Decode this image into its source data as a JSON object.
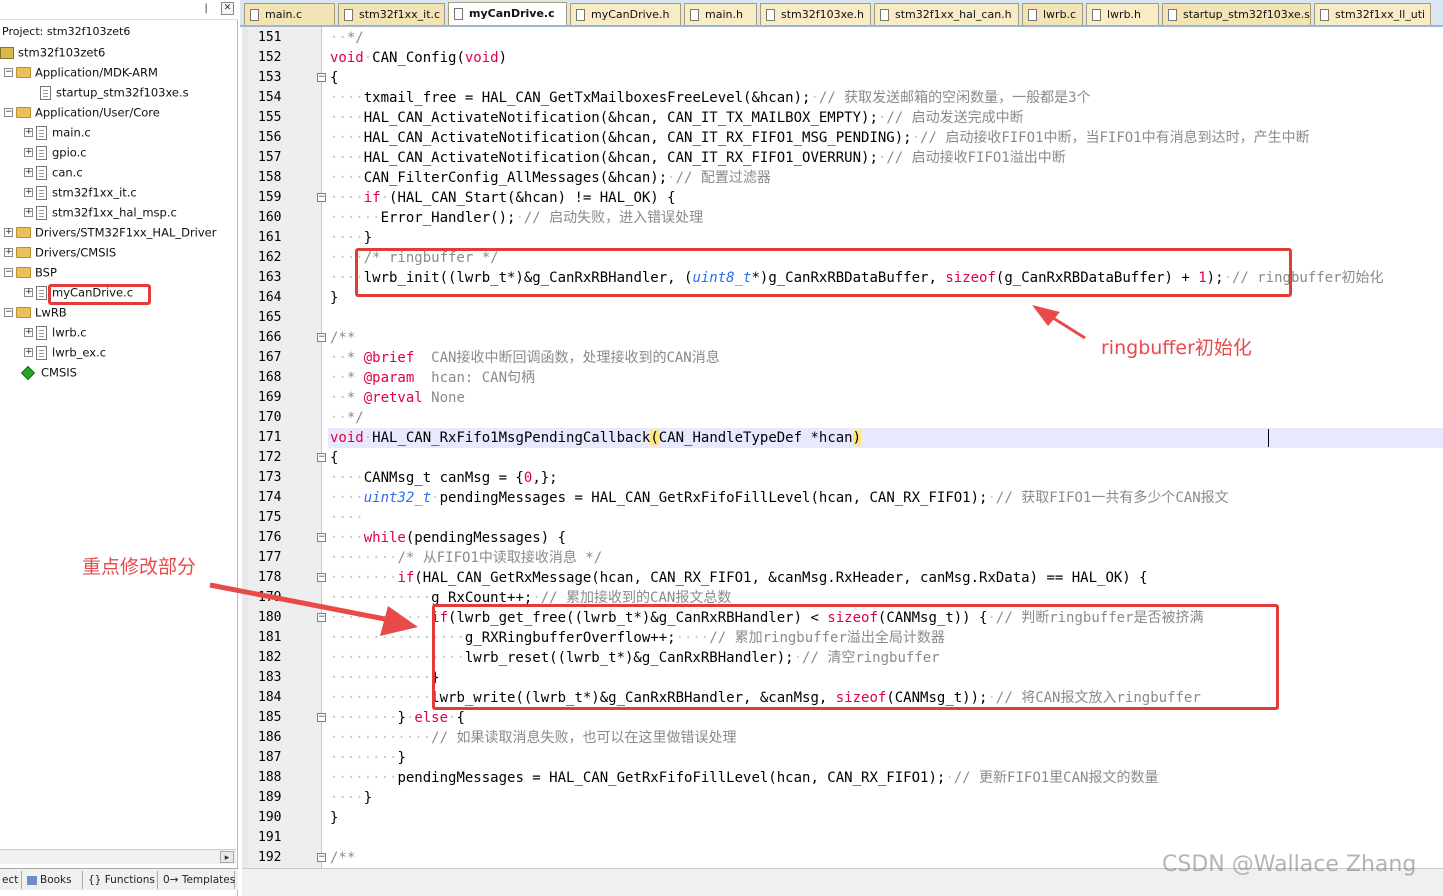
{
  "project": {
    "title": "Project: stm32f103zet6",
    "tree": [
      {
        "label": "stm32f103zet6",
        "kind": "project",
        "indent": 0
      },
      {
        "label": "Application/MDK-ARM",
        "kind": "folder",
        "indent": 1,
        "expander": "-"
      },
      {
        "label": "startup_stm32f103xe.s",
        "kind": "file",
        "indent": 3
      },
      {
        "label": "Application/User/Core",
        "kind": "folder",
        "indent": 1,
        "expander": "-"
      },
      {
        "label": "main.c",
        "kind": "file",
        "indent": 2,
        "expander": "+"
      },
      {
        "label": "gpio.c",
        "kind": "file",
        "indent": 2,
        "expander": "+"
      },
      {
        "label": "can.c",
        "kind": "file",
        "indent": 2,
        "expander": "+"
      },
      {
        "label": "stm32f1xx_it.c",
        "kind": "file",
        "indent": 2,
        "expander": "+"
      },
      {
        "label": "stm32f1xx_hal_msp.c",
        "kind": "file",
        "indent": 2,
        "expander": "+"
      },
      {
        "label": "Drivers/STM32F1xx_HAL_Driver",
        "kind": "folder",
        "indent": 1,
        "expander": "+"
      },
      {
        "label": "Drivers/CMSIS",
        "kind": "folder",
        "indent": 1,
        "expander": "+"
      },
      {
        "label": "BSP",
        "kind": "folder",
        "indent": 1,
        "expander": "-"
      },
      {
        "label": "myCanDrive.c",
        "kind": "file",
        "indent": 2,
        "expander": "+"
      },
      {
        "label": "LwRB",
        "kind": "folder",
        "indent": 1,
        "expander": "-"
      },
      {
        "label": "lwrb.c",
        "kind": "file",
        "indent": 2,
        "expander": "+"
      },
      {
        "label": "lwrb_ex.c",
        "kind": "file",
        "indent": 2,
        "expander": "+"
      },
      {
        "label": "CMSIS",
        "kind": "gem",
        "indent": 1
      }
    ],
    "bottom_tabs": [
      "ect",
      "Books",
      "{} Functions",
      "0→ Templates"
    ]
  },
  "tabs": [
    {
      "label": "main.c",
      "type": "c",
      "active": false
    },
    {
      "label": "stm32f1xx_it.c",
      "type": "c",
      "active": false
    },
    {
      "label": "myCanDrive.c",
      "type": "c",
      "active": true
    },
    {
      "label": "myCanDrive.h",
      "type": "h",
      "active": false
    },
    {
      "label": "main.h",
      "type": "h",
      "active": false
    },
    {
      "label": "stm32f103xe.h",
      "type": "h",
      "active": false
    },
    {
      "label": "stm32f1xx_hal_can.h",
      "type": "h",
      "active": false
    },
    {
      "label": "lwrb.c",
      "type": "c",
      "active": false
    },
    {
      "label": "lwrb.h",
      "type": "h",
      "active": false
    },
    {
      "label": "startup_stm32f103xe.s",
      "type": "s",
      "active": false
    },
    {
      "label": "stm32f1xx_ll_uti",
      "type": "h",
      "active": false
    }
  ],
  "colors": {
    "keyword": "#e00040",
    "type": "#2a6ef3",
    "comment": "#8a8a8a",
    "annotation": "#e33a3a"
  },
  "code": [
    {
      "n": 151,
      "fold": "",
      "segs": [
        [
          "ws",
          "··"
        ],
        [
          "cm",
          "*/"
        ]
      ]
    },
    {
      "n": 152,
      "fold": "",
      "segs": [
        [
          "kw",
          "void"
        ],
        [
          "ws",
          "·"
        ],
        [
          "",
          "CAN_Config("
        ],
        [
          "kw",
          "void"
        ],
        [
          "",
          ")"
        ]
      ]
    },
    {
      "n": 153,
      "fold": "-",
      "segs": [
        [
          "",
          "{"
        ]
      ]
    },
    {
      "n": 154,
      "fold": "",
      "segs": [
        [
          "ws",
          "····"
        ],
        [
          "",
          "txmail_free = HAL_CAN_GetTxMailboxesFreeLevel(&hcan);"
        ],
        [
          "ws",
          "·"
        ],
        [
          "cm",
          "// 获取发送邮箱的空闲数量，一般都是3个"
        ]
      ]
    },
    {
      "n": 155,
      "fold": "",
      "segs": [
        [
          "ws",
          "····"
        ],
        [
          "",
          "HAL_CAN_ActivateNotification(&hcan, CAN_IT_TX_MAILBOX_EMPTY);"
        ],
        [
          "ws",
          "·"
        ],
        [
          "cm",
          "// 启动发送完成中断"
        ]
      ]
    },
    {
      "n": 156,
      "fold": "",
      "segs": [
        [
          "ws",
          "····"
        ],
        [
          "",
          "HAL_CAN_ActivateNotification(&hcan, CAN_IT_RX_FIFO1_MSG_PENDING);"
        ],
        [
          "ws",
          "·"
        ],
        [
          "cm",
          "// 启动接收FIFO1中断，当FIFO1中有消息到达时，产生中断"
        ]
      ]
    },
    {
      "n": 157,
      "fold": "",
      "segs": [
        [
          "ws",
          "····"
        ],
        [
          "",
          "HAL_CAN_ActivateNotification(&hcan, CAN_IT_RX_FIFO1_OVERRUN);"
        ],
        [
          "ws",
          "·"
        ],
        [
          "cm",
          "// 启动接收FIFO1溢出中断"
        ]
      ]
    },
    {
      "n": 158,
      "fold": "",
      "segs": [
        [
          "ws",
          "····"
        ],
        [
          "",
          "CAN_FilterConfig_AllMessages(&hcan);"
        ],
        [
          "ws",
          "·"
        ],
        [
          "cm",
          "// 配置过滤器"
        ]
      ]
    },
    {
      "n": 159,
      "fold": "-",
      "segs": [
        [
          "ws",
          "····"
        ],
        [
          "kw",
          "if"
        ],
        [
          "",
          ""
        ],
        [
          "ws",
          "·"
        ],
        [
          "",
          "(HAL_CAN_Start(&hcan) != HAL_OK) {"
        ]
      ]
    },
    {
      "n": 160,
      "fold": "",
      "segs": [
        [
          "ws",
          "······"
        ],
        [
          "",
          "Error_Handler();"
        ],
        [
          "ws",
          "·"
        ],
        [
          "cm",
          "// 启动失败，进入错误处理"
        ]
      ]
    },
    {
      "n": 161,
      "fold": "",
      "segs": [
        [
          "ws",
          "····"
        ],
        [
          "",
          "}"
        ]
      ]
    },
    {
      "n": 162,
      "fold": "",
      "segs": [
        [
          "ws",
          "····"
        ],
        [
          "cm",
          "/* ringbuffer */"
        ]
      ]
    },
    {
      "n": 163,
      "fold": "",
      "segs": [
        [
          "ws",
          "····"
        ],
        [
          "",
          "lwrb_init((lwrb_t*)&g_CanRxRBHandler, ("
        ],
        [
          "ty",
          "uint8_t"
        ],
        [
          "",
          "*)g_CanRxRBDataBuffer, "
        ],
        [
          "kw",
          "sizeof"
        ],
        [
          "",
          "(g_CanRxRBDataBuffer) + "
        ],
        [
          "num",
          "1"
        ],
        [
          "",
          ");"
        ],
        [
          "ws",
          "·"
        ],
        [
          "cm",
          "// ringbuffer初始化"
        ]
      ]
    },
    {
      "n": 164,
      "fold": "",
      "segs": [
        [
          "",
          "}"
        ]
      ]
    },
    {
      "n": 165,
      "fold": "",
      "segs": []
    },
    {
      "n": 166,
      "fold": "-",
      "segs": [
        [
          "cm",
          "/**"
        ]
      ]
    },
    {
      "n": 167,
      "fold": "",
      "segs": [
        [
          "ws",
          "··"
        ],
        [
          "cm",
          "* "
        ],
        [
          "kw",
          "@brief"
        ],
        [
          "cm",
          "  CAN接收中断回调函数，处理接收到的CAN消息"
        ]
      ]
    },
    {
      "n": 168,
      "fold": "",
      "segs": [
        [
          "ws",
          "··"
        ],
        [
          "cm",
          "* "
        ],
        [
          "kw",
          "@param"
        ],
        [
          "cm",
          "  hcan: CAN句柄"
        ]
      ]
    },
    {
      "n": 169,
      "fold": "",
      "segs": [
        [
          "ws",
          "··"
        ],
        [
          "cm",
          "* "
        ],
        [
          "kw",
          "@retval"
        ],
        [
          "cm",
          " None"
        ]
      ]
    },
    {
      "n": 170,
      "fold": "",
      "segs": [
        [
          "ws",
          "··"
        ],
        [
          "cm",
          "*/"
        ]
      ]
    },
    {
      "n": 171,
      "fold": "",
      "current": true,
      "segs": [
        [
          "kw",
          "void"
        ],
        [
          "ws",
          "·"
        ],
        [
          "",
          "HAL_CAN_RxFifo1MsgPendingCallback"
        ],
        [
          "hl",
          "("
        ],
        [
          "",
          "CAN_HandleTypeDef *hcan"
        ],
        [
          "hl",
          ")"
        ]
      ]
    },
    {
      "n": 172,
      "fold": "-",
      "segs": [
        [
          "",
          "{"
        ]
      ]
    },
    {
      "n": 173,
      "fold": "",
      "segs": [
        [
          "ws",
          "····"
        ],
        [
          "",
          "CANMsg_t canMsg = {"
        ],
        [
          "num",
          "0"
        ],
        [
          "",
          ",};"
        ]
      ]
    },
    {
      "n": 174,
      "fold": "",
      "segs": [
        [
          "ws",
          "····"
        ],
        [
          "ty",
          "uint32_t"
        ],
        [
          "ws",
          "·"
        ],
        [
          "",
          "pendingMessages = HAL_CAN_GetRxFifoFillLevel(hcan, CAN_RX_FIFO1);"
        ],
        [
          "ws",
          "·"
        ],
        [
          "cm",
          "// 获取FIFO1一共有多少个CAN报文"
        ]
      ]
    },
    {
      "n": 175,
      "fold": "",
      "segs": [
        [
          "ws",
          "····"
        ]
      ]
    },
    {
      "n": 176,
      "fold": "-",
      "segs": [
        [
          "ws",
          "····"
        ],
        [
          "kw",
          "while"
        ],
        [
          "",
          "(pendingMessages) {"
        ]
      ]
    },
    {
      "n": 177,
      "fold": "",
      "segs": [
        [
          "ws",
          "········"
        ],
        [
          "cm",
          "/* 从FIFO1中读取接收消息 */"
        ]
      ]
    },
    {
      "n": 178,
      "fold": "-",
      "segs": [
        [
          "ws",
          "········"
        ],
        [
          "kw",
          "if"
        ],
        [
          "",
          "(HAL_CAN_GetRxMessage(hcan, CAN_RX_FIFO1, &canMsg.RxHeader, canMsg.RxData) == HAL_OK) {"
        ]
      ]
    },
    {
      "n": 179,
      "fold": "",
      "segs": [
        [
          "ws",
          "············"
        ],
        [
          "",
          "g_RxCount++;"
        ],
        [
          "ws",
          "·"
        ],
        [
          "cm",
          "// 累加接收到的CAN报文总数"
        ]
      ]
    },
    {
      "n": 180,
      "fold": "-",
      "segs": [
        [
          "ws",
          "············"
        ],
        [
          "kw",
          "if"
        ],
        [
          "",
          "(lwrb_get_free((lwrb_t*)&g_CanRxRBHandler) < "
        ],
        [
          "kw",
          "sizeof"
        ],
        [
          "",
          "(CANMsg_t)) {"
        ],
        [
          "ws",
          "·"
        ],
        [
          "cm",
          "// 判断ringbuffer是否被挤满"
        ]
      ]
    },
    {
      "n": 181,
      "fold": "",
      "segs": [
        [
          "ws",
          "················"
        ],
        [
          "",
          "g_RXRingbufferOverflow++;"
        ],
        [
          "ws",
          "····"
        ],
        [
          "cm",
          "// 累加ringbuffer溢出全局计数器"
        ]
      ]
    },
    {
      "n": 182,
      "fold": "",
      "segs": [
        [
          "ws",
          "················"
        ],
        [
          "",
          "lwrb_reset((lwrb_t*)&g_CanRxRBHandler);"
        ],
        [
          "ws",
          "·"
        ],
        [
          "cm",
          "// 清空ringbuffer"
        ]
      ]
    },
    {
      "n": 183,
      "fold": "",
      "segs": [
        [
          "ws",
          "············"
        ],
        [
          "",
          "}"
        ]
      ]
    },
    {
      "n": 184,
      "fold": "",
      "segs": [
        [
          "ws",
          "············"
        ],
        [
          "",
          "lwrb_write((lwrb_t*)&g_CanRxRBHandler, &canMsg, "
        ],
        [
          "kw",
          "sizeof"
        ],
        [
          "",
          "(CANMsg_t));"
        ],
        [
          "ws",
          "·"
        ],
        [
          "cm",
          "// 将CAN报文放入ringbuffer"
        ]
      ]
    },
    {
      "n": 185,
      "fold": "-",
      "segs": [
        [
          "ws",
          "········"
        ],
        [
          "",
          "}"
        ],
        [
          "ws",
          "·"
        ],
        [
          "kw",
          "else"
        ],
        [
          "",
          ""
        ],
        [
          "ws",
          "·"
        ],
        [
          "",
          "{"
        ]
      ]
    },
    {
      "n": 186,
      "fold": "",
      "segs": [
        [
          "ws",
          "············"
        ],
        [
          "cm",
          "// 如果读取消息失败，也可以在这里做错误处理"
        ]
      ]
    },
    {
      "n": 187,
      "fold": "",
      "segs": [
        [
          "ws",
          "········"
        ],
        [
          "",
          "}"
        ]
      ]
    },
    {
      "n": 188,
      "fold": "",
      "segs": [
        [
          "ws",
          "········"
        ],
        [
          "",
          "pendingMessages = HAL_CAN_GetRxFifoFillLevel(hcan, CAN_RX_FIFO1);"
        ],
        [
          "ws",
          "·"
        ],
        [
          "cm",
          "// 更新FIFO1里CAN报文的数量"
        ]
      ]
    },
    {
      "n": 189,
      "fold": "",
      "segs": [
        [
          "ws",
          "····"
        ],
        [
          "",
          "}"
        ]
      ]
    },
    {
      "n": 190,
      "fold": "",
      "segs": [
        [
          "",
          "}"
        ]
      ]
    },
    {
      "n": 191,
      "fold": "",
      "segs": []
    },
    {
      "n": 192,
      "fold": "-",
      "segs": [
        [
          "cm",
          "/**"
        ]
      ]
    }
  ],
  "annotations": {
    "ringbuffer_init": "ringbuffer初始化",
    "key_changes": "重点修改部分"
  },
  "watermark": "CSDN @Wallace Zhang"
}
